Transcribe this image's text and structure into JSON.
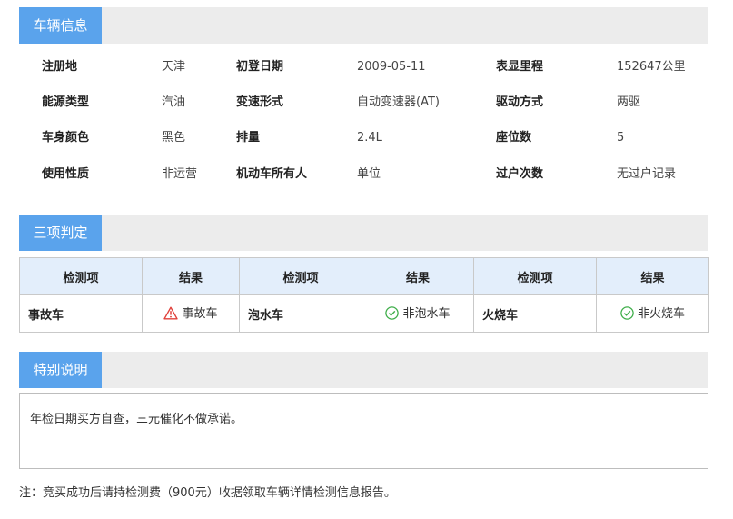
{
  "sections": {
    "vehicle_info": "车辆信息",
    "three_checks": "三项判定",
    "special_note": "特别说明"
  },
  "vehicle_info": {
    "rows": [
      [
        {
          "label": "注册地",
          "value": "天津"
        },
        {
          "label": "初登日期",
          "value": "2009-05-11"
        },
        {
          "label": "表显里程",
          "value": "152647公里"
        }
      ],
      [
        {
          "label": "能源类型",
          "value": "汽油"
        },
        {
          "label": "变速形式",
          "value": "自动变速器(AT)"
        },
        {
          "label": "驱动方式",
          "value": "两驱"
        }
      ],
      [
        {
          "label": "车身颜色",
          "value": "黑色"
        },
        {
          "label": "排量",
          "value": "2.4L"
        },
        {
          "label": "座位数",
          "value": "5"
        }
      ],
      [
        {
          "label": "使用性质",
          "value": "非运营"
        },
        {
          "label": "机动车所有人",
          "value": "单位"
        },
        {
          "label": "过户次数",
          "value": "无过户记录"
        }
      ]
    ]
  },
  "judge_table": {
    "headers": [
      "检测项",
      "结果",
      "检测项",
      "结果",
      "检测项",
      "结果"
    ],
    "items": [
      {
        "item": "事故车",
        "result": "事故车",
        "status": "warning",
        "color": "#e0413b"
      },
      {
        "item": "泡水车",
        "result": "非泡水车",
        "status": "ok",
        "color": "#3fae4a"
      },
      {
        "item": "火烧车",
        "result": "非火烧车",
        "status": "ok",
        "color": "#3fae4a"
      }
    ]
  },
  "special_note": {
    "text": "年检日期买方自查，三元催化不做承诺。"
  },
  "footer_note": "注：竞买成功后请持检测费（900元）收据领取车辆详情检测信息报告。",
  "colors": {
    "accent": "#5aa3ec",
    "header_bg": "#ececec",
    "table_header_bg": "#e3eefb"
  }
}
